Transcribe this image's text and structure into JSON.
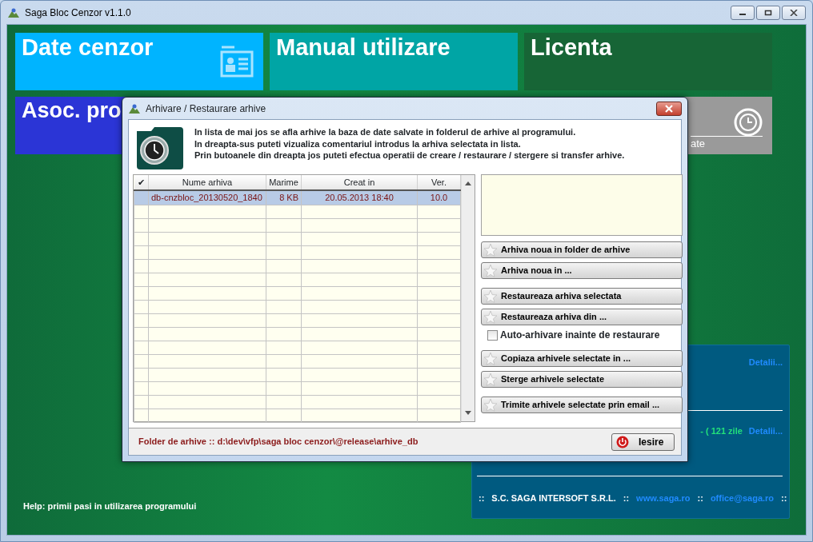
{
  "window": {
    "title": "Saga Bloc Cenzor v1.1.0"
  },
  "tiles": [
    {
      "title": "Date cenzor",
      "color": "#00b4ff"
    },
    {
      "title": "Manual utilizare",
      "color": "#00a5a5"
    },
    {
      "title": "Licenta",
      "color": "#176536"
    },
    {
      "title": "Asoc. pro",
      "color": "#2b35d6"
    },
    {
      "title": "ate",
      "color": "#9a9a9a"
    }
  ],
  "info_panel": {
    "sections": [
      {
        "items": [
          {
            "kind": "link",
            "text": "Detalii..."
          }
        ]
      },
      {
        "items": [
          {
            "kind": "notice",
            "text": "- ( 121 zile"
          },
          {
            "kind": "link",
            "text": "Detalii..."
          }
        ]
      }
    ],
    "footer": [
      {
        "kind": "sep",
        "text": "::"
      },
      {
        "kind": "text",
        "text": "S.C. SAGA INTERSOFT S.R.L."
      },
      {
        "kind": "sep",
        "text": "::"
      },
      {
        "kind": "link",
        "text": "www.saga.ro"
      },
      {
        "kind": "sep",
        "text": "::"
      },
      {
        "kind": "link",
        "text": "office@saga.ro"
      },
      {
        "kind": "sep",
        "text": "::"
      }
    ]
  },
  "help": "Help: primii pasi in utilizarea programului",
  "dialog": {
    "title": "Arhivare / Restaurare arhive",
    "intro": [
      "In lista de mai jos se afla arhive la baza de date salvate in folderul de arhive al programului.",
      "In dreapta-sus puteti vizualiza comentariul introdus la arhiva selectata in lista.",
      "Prin butoanele din dreapta jos puteti efectua operatii de creare / restaurare / stergere si transfer arhive."
    ],
    "table": {
      "columns": [
        "✔",
        "Nume arhiva",
        "Marime",
        "Creat in",
        "Ver."
      ],
      "rows": [
        {
          "selected": true,
          "cells": [
            "",
            "db-cnzbloc_20130520_1840",
            "8 KB",
            "20.05.2013 18:40",
            "10.0"
          ]
        }
      ]
    },
    "action_groups": [
      [
        {
          "kind": "button",
          "label": "Arhiva noua in folder de arhive"
        },
        {
          "kind": "button",
          "label": "Arhiva noua in ..."
        }
      ],
      [
        {
          "kind": "button",
          "label": "Restaureaza arhiva selectata"
        },
        {
          "kind": "button",
          "label": "Restaureaza arhiva din ..."
        },
        {
          "kind": "checkbox",
          "label": "Auto-arhivare inainte de restaurare",
          "checked": false
        }
      ],
      [
        {
          "kind": "button",
          "label": "Copiaza arhivele selectate in ..."
        },
        {
          "kind": "button",
          "label": "Sterge arhivele selectate"
        }
      ],
      [
        {
          "kind": "button",
          "label": "Trimite arhivele selectate prin email ..."
        }
      ]
    ],
    "folder": "Folder de arhive ::  d:\\dev\\vfp\\saga bloc cenzor\\@release\\arhive_db",
    "exit": "Iesire"
  }
}
